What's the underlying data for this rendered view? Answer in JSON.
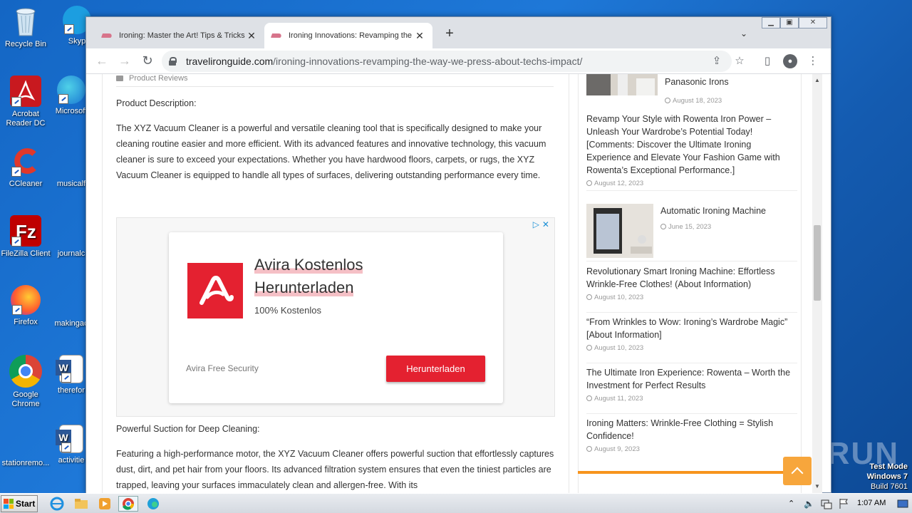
{
  "desktop": {
    "icons": [
      {
        "label": "Recycle Bin",
        "icon": "recycle-bin-icon"
      },
      {
        "label": "Skyp",
        "icon": "skype-icon"
      },
      {
        "label": "Acrobat Reader DC",
        "icon": "acrobat-icon"
      },
      {
        "label": "Microsoft",
        "icon": "edge-icon"
      },
      {
        "label": "CCleaner",
        "icon": "ccleaner-icon"
      },
      {
        "label": "musicalf",
        "icon": "file-icon"
      },
      {
        "label": "FileZilla Client",
        "icon": "filezilla-icon"
      },
      {
        "label": "journalc",
        "icon": "file-icon"
      },
      {
        "label": "Firefox",
        "icon": "firefox-icon"
      },
      {
        "label": "makingac",
        "icon": "file-icon"
      },
      {
        "label": "Google Chrome",
        "icon": "chrome-icon"
      },
      {
        "label": "therefor",
        "icon": "word-icon"
      },
      {
        "label": "stationremo...",
        "icon": "file-icon"
      },
      {
        "label": "activitie",
        "icon": "word-icon"
      }
    ],
    "watermark": "ANY RUN",
    "test_mode": [
      "Test Mode",
      "Windows 7",
      "Build 7601"
    ]
  },
  "browser": {
    "tabs": [
      {
        "title": "Ironing: Master the Art! Tips & Tricks",
        "active": false
      },
      {
        "title": "Ironing Innovations: Revamping the",
        "active": true
      }
    ],
    "new_tab": "+",
    "url_host": "travelironguide.com",
    "url_path": "/ironing-innovations-revamping-the-way-we-press-about-techs-impact/"
  },
  "article": {
    "category": "Product Reviews",
    "heading": "Product Description:",
    "paragraph1": "The XYZ Vacuum Cleaner is a powerful and versatile cleaning tool that is specifically designed to make your cleaning routine easier and more efficient. With its advanced features and innovative technology, this vacuum cleaner is sure to exceed your expectations. Whether you have hardwood floors, carpets, or rugs, the XYZ Vacuum Cleaner is equipped to handle all types of surfaces, delivering outstanding performance every time.",
    "heading2": "Powerful Suction for Deep Cleaning:",
    "paragraph2": "Featuring a high-performance motor, the XYZ Vacuum Cleaner offers powerful suction that effortlessly captures dust, dirt, and pet hair from your floors. Its advanced filtration system ensures that even the tiniest particles are trapped, leaving your surfaces immaculately clean and allergen-free. With its"
  },
  "ad": {
    "title_line1": "Avira Kostenlos",
    "title_line2": "Herunterladen",
    "subtitle": "100% Kostenlos",
    "brand": "Avira Free Security",
    "button": "Herunterladen",
    "brand_color": "#e42130"
  },
  "sidebar": {
    "items": [
      {
        "title": "Panasonic Irons",
        "date": "August 18, 2023"
      },
      {
        "title": "Revamp Your Style with Rowenta Iron Power – Unleash Your Wardrobe’s Potential Today! [Comments: Discover the Ultimate Ironing Experience and Elevate Your Fashion Game with Rowenta’s Exceptional Performance.]",
        "date": "August 12, 2023"
      },
      {
        "title": "Automatic Ironing Machine",
        "date": "June 15, 2023"
      },
      {
        "title": "Revolutionary Smart Ironing Machine: Effortless Wrinkle-Free Clothes! (About Information)",
        "date": "August 10, 2023"
      },
      {
        "title": "“From Wrinkles to Wow: Ironing’s Wardrobe Magic” [About Information]",
        "date": "August 10, 2023"
      },
      {
        "title": "The Ultimate Iron Experience: Rowenta – Worth the Investment for Perfect Results",
        "date": "August 11, 2023"
      },
      {
        "title": "Ironing Matters: Wrinkle-Free Clothing = Stylish Confidence!",
        "date": "August 9, 2023"
      }
    ],
    "accent_color": "#f7941d"
  },
  "taskbar": {
    "start": "Start",
    "clock": "1:07 AM"
  }
}
